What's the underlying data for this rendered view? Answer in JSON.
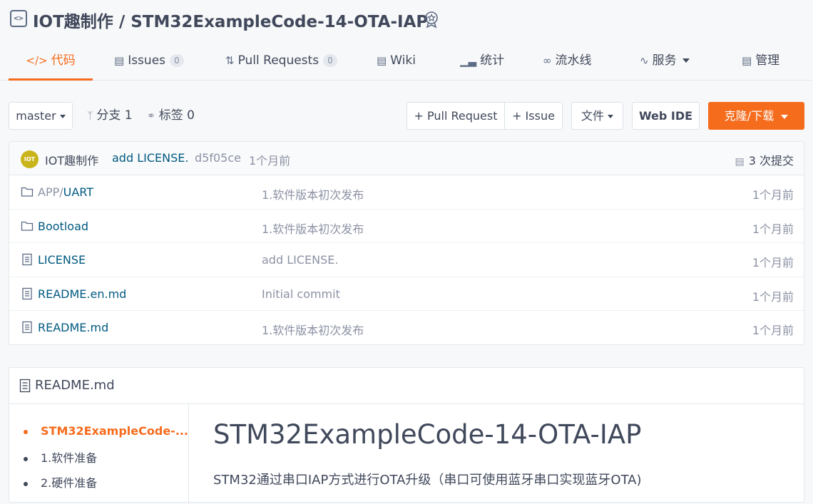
{
  "repo": {
    "owner": "IOT趣制作",
    "separator": " / ",
    "name": "STM32ExampleCode-14-OTA-IAP"
  },
  "tabs": [
    {
      "icon": "code-icon",
      "label": "代码",
      "active": true
    },
    {
      "icon": "issues-icon",
      "label": "Issues",
      "count": "0"
    },
    {
      "icon": "pull-request-icon",
      "label": "Pull Requests",
      "count": "0"
    },
    {
      "icon": "wiki-icon",
      "label": "Wiki"
    },
    {
      "icon": "stats-icon",
      "label": "统计"
    },
    {
      "icon": "pipeline-icon",
      "label": "流水线"
    },
    {
      "icon": "service-icon",
      "label": "服务"
    },
    {
      "icon": "manage-icon",
      "label": "管理"
    }
  ],
  "toolbar": {
    "branch": "master",
    "branches": "分支 1",
    "tags": "标签 0",
    "pull_request": "+ Pull Request",
    "issue": "+ Issue",
    "file": "文件",
    "web_ide": "Web IDE",
    "clone": "克隆/下载"
  },
  "commit": {
    "avatar_text": "IOT",
    "author": "IOT趣制作",
    "message": "add LICENSE.",
    "hash": "d5f05ce",
    "time": "1个月前",
    "count": "3 次提交"
  },
  "files": [
    {
      "type": "folder",
      "dir": "APP/",
      "name": "UART",
      "message": "1.软件版本初次发布",
      "time": "1个月前"
    },
    {
      "type": "folder",
      "dir": "",
      "name": "Bootload",
      "message": "1.软件版本初次发布",
      "time": "1个月前"
    },
    {
      "type": "file",
      "dir": "",
      "name": "LICENSE",
      "message": "add LICENSE.",
      "time": "1个月前"
    },
    {
      "type": "file",
      "dir": "",
      "name": "README.en.md",
      "message": "Initial commit",
      "time": "1个月前"
    },
    {
      "type": "file",
      "dir": "",
      "name": "README.md",
      "message": "1.软件版本初次发布",
      "time": "1个月前"
    }
  ],
  "readme": {
    "title": "README.md",
    "toc": [
      "STM32ExampleCode-...",
      "1.软件准备",
      "2.硬件准备"
    ],
    "heading": "STM32ExampleCode-14-OTA-IAP",
    "paragraph": "STM32通过串口IAP方式进行OTA升级（串口可使用蓝牙串口实现蓝牙OTA)"
  },
  "colors": {
    "accent": "#f56c1d",
    "link": "#005980",
    "muted": "#8c92a4"
  }
}
